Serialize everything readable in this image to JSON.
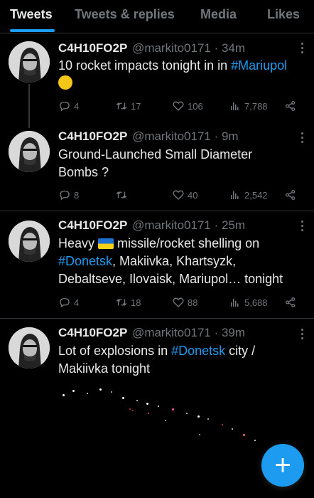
{
  "tabs": [
    {
      "label": "Tweets"
    },
    {
      "label": "Tweets & replies"
    },
    {
      "label": "Media"
    },
    {
      "label": "Likes"
    }
  ],
  "tweets": [
    {
      "name": "C4H10FO2P",
      "handle": "@markito0171 · 34m",
      "text_pre": "10 rocket impacts tonight in in ",
      "hashtag": "#Mariupol",
      "replies": "4",
      "retweets": "17",
      "likes": "106",
      "views": "7,788"
    },
    {
      "name": "C4H10FO2P",
      "handle": "@markito0171 · 9m",
      "text": "Ground-Launched Small Diameter Bombs ?",
      "replies": "8",
      "retweets": "",
      "likes": "40",
      "views": "2,542"
    },
    {
      "name": "C4H10FO2P",
      "handle": "@markito0171 · 25m",
      "text_a": "Heavy ",
      "text_b": " missile/rocket shelling on ",
      "hashtag": "#Donetsk",
      "text_c": ", Makiivka, Khartsyzk, Debaltseve, Ilovaisk, Mariupol… tonight",
      "replies": "4",
      "retweets": "18",
      "likes": "88",
      "views": "5,688"
    },
    {
      "name": "C4H10FO2P",
      "handle": "@markito0171 · 39m",
      "text_a": "Lot of explosions in ",
      "hashtag": "#Donetsk",
      "text_b": " city / Makiivka tonight"
    }
  ],
  "icons": {
    "reply": "reply-icon",
    "retweet": "retweet-icon",
    "like": "heart-icon",
    "views": "views-icon",
    "share": "share-icon",
    "compose": "plus-icon"
  },
  "colors": {
    "accent": "#1d9bf0",
    "muted": "#71767b",
    "text": "#e7e9ea",
    "background": "#000000"
  }
}
